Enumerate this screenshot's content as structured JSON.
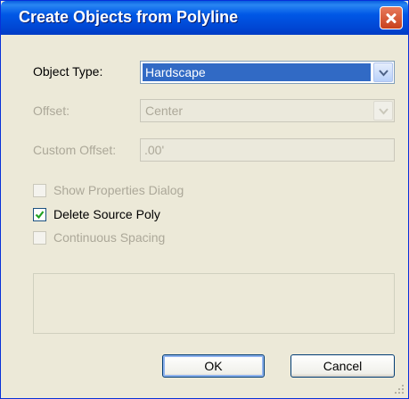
{
  "window": {
    "title": "Create Objects from Polyline"
  },
  "object_type": {
    "label": "Object Type:",
    "value": "Hardscape"
  },
  "offset": {
    "label": "Offset:",
    "value": "Center"
  },
  "custom_offset": {
    "label": "Custom Offset:",
    "value": ".00'"
  },
  "options": [
    {
      "label": "Show Properties Dialog",
      "checked": false,
      "enabled": false
    },
    {
      "label": "Delete Source Poly",
      "checked": true,
      "enabled": true
    },
    {
      "label": "Continuous Spacing",
      "checked": false,
      "enabled": false
    }
  ],
  "buttons": {
    "ok": "OK",
    "cancel": "Cancel"
  }
}
